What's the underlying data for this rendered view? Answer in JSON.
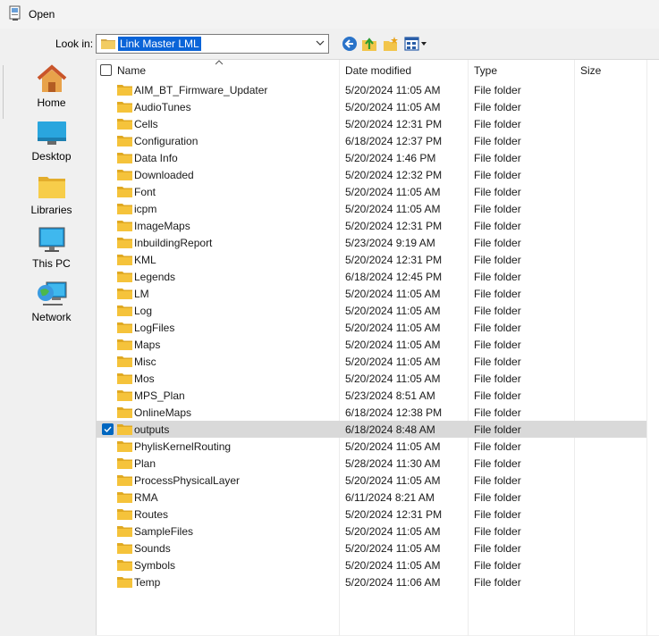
{
  "window": {
    "title": "Open"
  },
  "toolbar": {
    "look_in_label": "Look in:",
    "look_in_value": "Link Master LML"
  },
  "places": [
    {
      "label": "Home",
      "icon": "home-icon"
    },
    {
      "label": "Desktop",
      "icon": "desktop-icon"
    },
    {
      "label": "Libraries",
      "icon": "libraries-icon"
    },
    {
      "label": "This PC",
      "icon": "this-pc-icon"
    },
    {
      "label": "Network",
      "icon": "network-icon"
    }
  ],
  "columns": {
    "name": "Name",
    "date": "Date modified",
    "type": "Type",
    "size": "Size"
  },
  "colors": {
    "folder": "#f5c33b",
    "folder_dark": "#e0a922",
    "selection": "#d9d9d9",
    "accent": "#0067c0"
  },
  "files": [
    {
      "name": "AIM_BT_Firmware_Updater",
      "date": "5/20/2024 11:05 AM",
      "type": "File folder"
    },
    {
      "name": "AudioTunes",
      "date": "5/20/2024 11:05 AM",
      "type": "File folder"
    },
    {
      "name": "Cells",
      "date": "5/20/2024 12:31 PM",
      "type": "File folder"
    },
    {
      "name": "Configuration",
      "date": "6/18/2024 12:37 PM",
      "type": "File folder"
    },
    {
      "name": "Data Info",
      "date": "5/20/2024 1:46 PM",
      "type": "File folder"
    },
    {
      "name": "Downloaded",
      "date": "5/20/2024 12:32 PM",
      "type": "File folder"
    },
    {
      "name": "Font",
      "date": "5/20/2024 11:05 AM",
      "type": "File folder"
    },
    {
      "name": "icpm",
      "date": "5/20/2024 11:05 AM",
      "type": "File folder"
    },
    {
      "name": "ImageMaps",
      "date": "5/20/2024 12:31 PM",
      "type": "File folder"
    },
    {
      "name": "InbuildingReport",
      "date": "5/23/2024 9:19 AM",
      "type": "File folder"
    },
    {
      "name": "KML",
      "date": "5/20/2024 12:31 PM",
      "type": "File folder"
    },
    {
      "name": "Legends",
      "date": "6/18/2024 12:45 PM",
      "type": "File folder"
    },
    {
      "name": "LM",
      "date": "5/20/2024 11:05 AM",
      "type": "File folder"
    },
    {
      "name": "Log",
      "date": "5/20/2024 11:05 AM",
      "type": "File folder"
    },
    {
      "name": "LogFiles",
      "date": "5/20/2024 11:05 AM",
      "type": "File folder"
    },
    {
      "name": "Maps",
      "date": "5/20/2024 11:05 AM",
      "type": "File folder"
    },
    {
      "name": "Misc",
      "date": "5/20/2024 11:05 AM",
      "type": "File folder"
    },
    {
      "name": "Mos",
      "date": "5/20/2024 11:05 AM",
      "type": "File folder"
    },
    {
      "name": "MPS_Plan",
      "date": "5/23/2024 8:51 AM",
      "type": "File folder"
    },
    {
      "name": "OnlineMaps",
      "date": "6/18/2024 12:38 PM",
      "type": "File folder"
    },
    {
      "name": "outputs",
      "date": "6/18/2024 8:48 AM",
      "type": "File folder",
      "selected": true
    },
    {
      "name": "PhylisKernelRouting",
      "date": "5/20/2024 11:05 AM",
      "type": "File folder"
    },
    {
      "name": "Plan",
      "date": "5/28/2024 11:30 AM",
      "type": "File folder"
    },
    {
      "name": "ProcessPhysicalLayer",
      "date": "5/20/2024 11:05 AM",
      "type": "File folder"
    },
    {
      "name": "RMA",
      "date": "6/11/2024 8:21 AM",
      "type": "File folder"
    },
    {
      "name": "Routes",
      "date": "5/20/2024 12:31 PM",
      "type": "File folder"
    },
    {
      "name": "SampleFiles",
      "date": "5/20/2024 11:05 AM",
      "type": "File folder"
    },
    {
      "name": "Sounds",
      "date": "5/20/2024 11:05 AM",
      "type": "File folder"
    },
    {
      "name": "Symbols",
      "date": "5/20/2024 11:05 AM",
      "type": "File folder"
    },
    {
      "name": "Temp",
      "date": "5/20/2024 11:06 AM",
      "type": "File folder"
    }
  ]
}
